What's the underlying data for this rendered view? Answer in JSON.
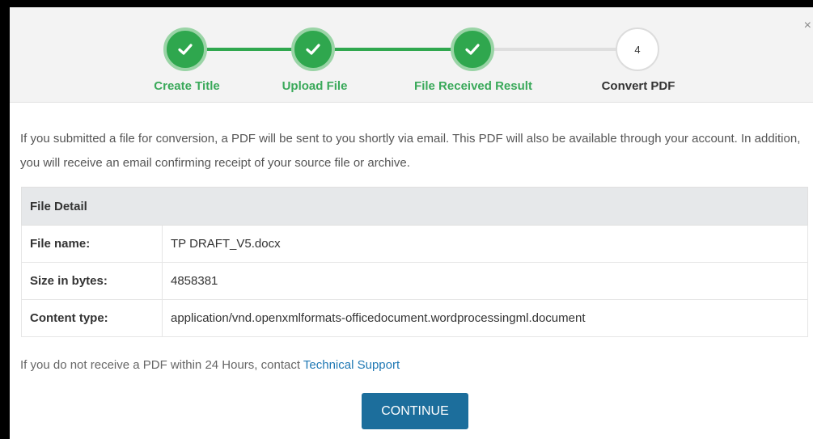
{
  "stepper": {
    "steps": [
      {
        "label": "Create Title",
        "state": "done",
        "icon": "check-icon"
      },
      {
        "label": "Upload File",
        "state": "done",
        "icon": "check-icon"
      },
      {
        "label": "File Received Result",
        "state": "done",
        "icon": "check-icon"
      },
      {
        "label": "Convert PDF",
        "state": "current",
        "number": "4"
      }
    ]
  },
  "close_glyph": "×",
  "intro_text": "If you submitted a file for conversion, a PDF will be sent to you shortly via email. This PDF will also be available through your account. In addition, you will receive an email confirming receipt of your source file or archive.",
  "file_detail": {
    "header": "File Detail",
    "rows": [
      {
        "key": "File name:",
        "value": "TP DRAFT_V5.docx"
      },
      {
        "key": "Size in bytes:",
        "value": "4858381"
      },
      {
        "key": "Content type:",
        "value": "application/vnd.openxmlformats-officedocument.wordprocessingml.document"
      }
    ]
  },
  "footer": {
    "text": "If you do not receive a PDF within 24 Hours, contact ",
    "link_label": "Technical Support"
  },
  "continue_label": "CONTINUE",
  "colors": {
    "accent_green": "#2fa74e",
    "button_blue": "#1c6e9c",
    "link_blue": "#1f78b4"
  }
}
